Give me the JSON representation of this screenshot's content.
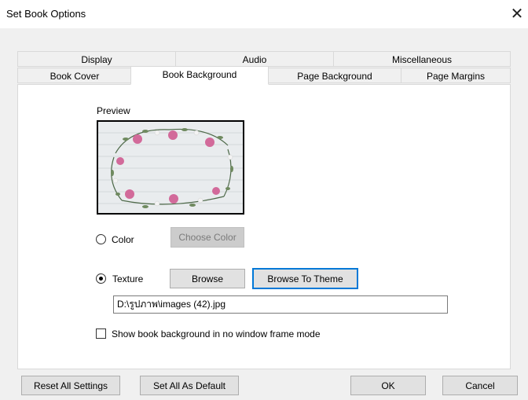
{
  "window": {
    "title": "Set Book Options",
    "close_glyph": "✕"
  },
  "tabs_back_row": [
    "Display",
    "Audio",
    "Miscellaneous"
  ],
  "tabs_front_row": [
    "Book Cover",
    "Book Background",
    "Page Background",
    "Page Margins"
  ],
  "active_tab": "Book Background",
  "preview": {
    "label": "Preview"
  },
  "background_mode": {
    "color_label": "Color",
    "texture_label": "Texture",
    "selected": "Texture"
  },
  "buttons": {
    "choose_color": "Choose Color",
    "browse": "Browse",
    "browse_to_theme": "Browse To Theme",
    "reset_all": "Reset All Settings",
    "set_all_default": "Set All As Default",
    "ok": "OK",
    "cancel": "Cancel"
  },
  "texture_path": "D:\\รูปภาพ\\images (42).jpg",
  "options": {
    "show_bg_no_frame": "Show book background in no window frame mode",
    "show_bg_no_frame_checked": false
  },
  "colors": {
    "accent": "#0078d7",
    "panel": "#ffffff",
    "dialog": "#f0f0f0"
  }
}
